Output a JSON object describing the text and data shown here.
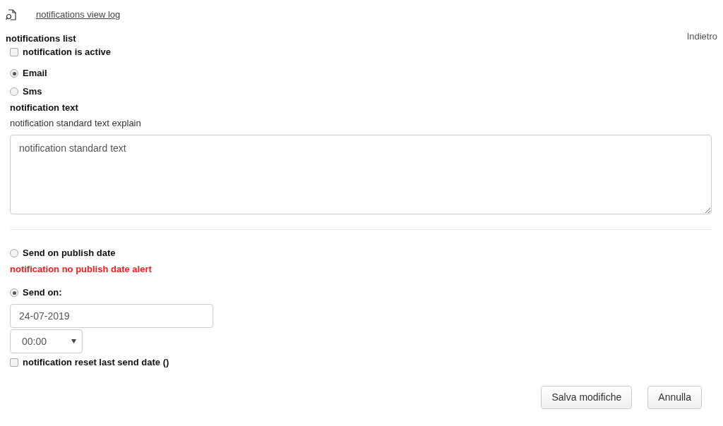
{
  "log_link": "notifications view log",
  "back_link": "Indietro",
  "section_title": "notifications list",
  "active_checkbox": {
    "label": "notification is active",
    "checked": false
  },
  "channels": [
    {
      "label": "Email",
      "selected": true
    },
    {
      "label": "Sms",
      "selected": false
    }
  ],
  "text_title": "notification text",
  "text_explain": "notification standard text explain",
  "text_area": {
    "value": "notification standard text"
  },
  "send_options": [
    {
      "kind": "publish",
      "label": "Send on publish date",
      "selected": false,
      "alert": "notification no publish date alert"
    },
    {
      "kind": "date",
      "label": "Send on:",
      "selected": true,
      "date": "24-07-2019",
      "time": "00:00"
    }
  ],
  "reset_checkbox": {
    "label": "notification reset last send date ()",
    "checked": false
  },
  "buttons": [
    "Salva modifiche",
    "Annulla"
  ]
}
